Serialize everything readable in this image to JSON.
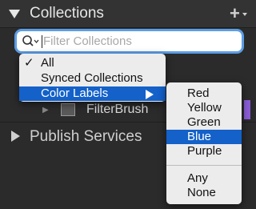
{
  "panel": {
    "title": "Collections",
    "add_symbol": "+"
  },
  "search": {
    "placeholder": "Filter Collections",
    "value": ""
  },
  "collection_row": {
    "expander": "▶",
    "label": "FilterBrush"
  },
  "publish": {
    "title": "Publish Services"
  },
  "main_menu": {
    "items": [
      {
        "check": "✓",
        "label": "All"
      },
      {
        "check": "",
        "label": "Synced Collections"
      },
      {
        "check": "",
        "label": "Color Labels"
      }
    ]
  },
  "color_menu": {
    "items": [
      "Red",
      "Yellow",
      "Green",
      "Blue",
      "Purple"
    ],
    "extra_items": [
      "Any",
      "None"
    ]
  },
  "colors": {
    "highlight": "#1361c9",
    "focus_ring": "#5b9ee6",
    "purple_label": "#8a5cd6"
  }
}
